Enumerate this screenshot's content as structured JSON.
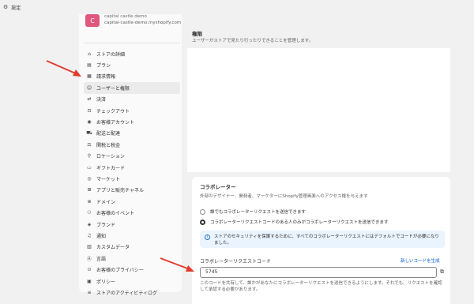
{
  "topbar": {
    "title": "設定"
  },
  "store": {
    "avatar_initial": "C",
    "name": "capital castle demo",
    "domain": "capital-castle-demo.myshopify.com"
  },
  "sidebar": {
    "items": [
      {
        "icon": "store-icon",
        "glyph": "⌂",
        "label": "ストアの詳細"
      },
      {
        "icon": "plan-icon",
        "glyph": "▤",
        "label": "プラン"
      },
      {
        "icon": "billing-icon",
        "glyph": "▦",
        "label": "請求情報"
      },
      {
        "icon": "users-icon",
        "glyph": "☺",
        "label": "ユーザーと権限",
        "active": true
      },
      {
        "icon": "payments-icon",
        "glyph": "⇄",
        "label": "決済"
      },
      {
        "icon": "checkout-icon",
        "glyph": "⊡",
        "label": "チェックアウト"
      },
      {
        "icon": "customer-accounts-icon",
        "glyph": "◉",
        "label": "お客様アカウント"
      },
      {
        "icon": "shipping-icon",
        "glyph": "⛟",
        "label": "配送と配達"
      },
      {
        "icon": "taxes-icon",
        "glyph": "⚖",
        "label": "関税と税金"
      },
      {
        "icon": "location-icon",
        "glyph": "⚲",
        "label": "ロケーション"
      },
      {
        "icon": "gift-card-icon",
        "glyph": "▭",
        "label": "ギフトカード"
      },
      {
        "icon": "markets-icon",
        "glyph": "◎",
        "label": "マーケット"
      },
      {
        "icon": "apps-icon",
        "glyph": "⊞",
        "label": "アプリと販売チャネル"
      },
      {
        "icon": "domains-icon",
        "glyph": "⊕",
        "label": "ドメイン"
      },
      {
        "icon": "customer-events-icon",
        "glyph": "⚇",
        "label": "お客様のイベント"
      },
      {
        "icon": "brand-icon",
        "glyph": "◈",
        "label": "ブランド"
      },
      {
        "icon": "notifications-icon",
        "glyph": "♫",
        "label": "通知"
      },
      {
        "icon": "custom-data-icon",
        "glyph": "▥",
        "label": "カスタムデータ"
      },
      {
        "icon": "languages-icon",
        "glyph": "Ⓐ",
        "label": "言語"
      },
      {
        "icon": "privacy-icon",
        "glyph": "⊙",
        "label": "お客様のプライバシー"
      },
      {
        "icon": "policies-icon",
        "glyph": "▣",
        "label": "ポリシー"
      },
      {
        "icon": "activity-log-icon",
        "glyph": "≡",
        "label": "ストアのアクティビティログ"
      }
    ]
  },
  "permissions": {
    "title": "権限",
    "subtitle": "ユーザーがストアで見たり行ったりできることを管理します。"
  },
  "collaborators": {
    "title": "コラボレーター",
    "description": "外部のデザイナー、開発者、マーケターにShopify管理画面へのアクセス権を与えます",
    "option_anyone": "誰でもコラボレーターリクエストを送信できます",
    "option_code": "コラボレーターリクエストコードのある人のみがコラボレーターリクエストを送信できます",
    "selected": "option_code",
    "info": "ストアのセキュリティを保護するために、すべてのコラボレーターリクエストにはデフォルトでコードが必要になりました。",
    "code_label": "コラボレーターリクエストコード",
    "new_code_link": "新しいコードを生成",
    "code_value": "5745",
    "code_help": "このコードを共有して、誰かがあなたにコラボレーターリクエストを送信できるようにします。それでも、リクエストを確認して承認する必要があります。"
  },
  "colors": {
    "accent_link": "#005bd3",
    "arrow": "#e03c2e",
    "avatar": "#e0567d",
    "info_bg": "#eaf4ff"
  }
}
